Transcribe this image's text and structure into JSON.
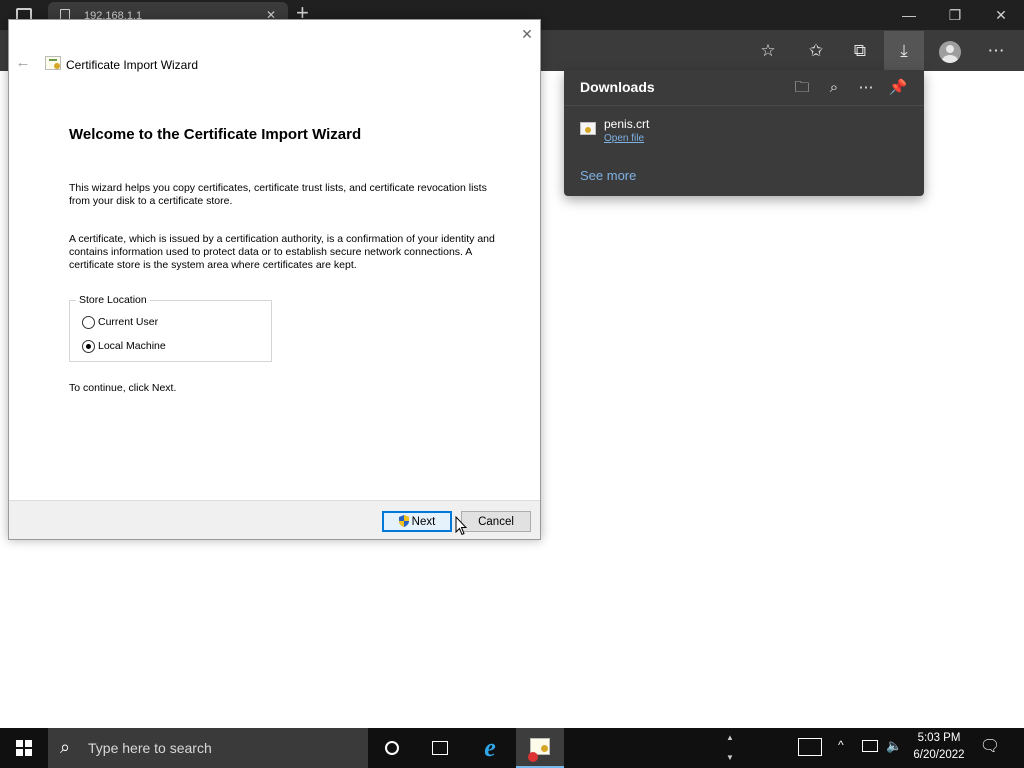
{
  "browser": {
    "tab_title": "192.168.1.1",
    "tab_close": "✕",
    "new_tab": "+",
    "window_minimize": "—",
    "window_restore": "❐",
    "window_close": "✕",
    "toolbar": {
      "add_favorite_icon": "☆",
      "favorites_icon": "✩",
      "collections_icon": "⧉",
      "downloads_icon": "⤓",
      "more_icon": "⋯"
    }
  },
  "downloads": {
    "title": "Downloads",
    "folder_icon": "🗀",
    "search_icon": "⌕",
    "more_icon": "⋯",
    "pin_icon": "📌",
    "items": [
      {
        "file_name": "penis.crt",
        "action": "Open file"
      }
    ],
    "see_more": "See more"
  },
  "wizard": {
    "window_title": "Certificate Import Wizard",
    "close_glyph": "✕",
    "back_glyph": "←",
    "heading": "Welcome to the Certificate Import Wizard",
    "para1": "This wizard helps you copy certificates, certificate trust lists, and certificate revocation lists from your disk to a certificate store.",
    "para2": "A certificate, which is issued by a certification authority, is a confirmation of your identity and contains information used to protect data or to establish secure network connections. A certificate store is the system area where certificates are kept.",
    "store_location": {
      "legend": "Store Location",
      "options": [
        {
          "label": "Current User",
          "checked": false
        },
        {
          "label": "Local Machine",
          "checked": true
        }
      ]
    },
    "continue_text": "To continue, click Next.",
    "next_label": "Next",
    "cancel_label": "Cancel"
  },
  "taskbar": {
    "search_placeholder": "Type here to search",
    "search_glyph": "⌕",
    "ie_glyph": "e",
    "scroll_up": "▲",
    "scroll_down": "▼",
    "tray_chevron": "^",
    "volume_glyph": "🔈",
    "time": "5:03 PM",
    "date": "6/20/2022",
    "notification_glyph": "🗨"
  }
}
